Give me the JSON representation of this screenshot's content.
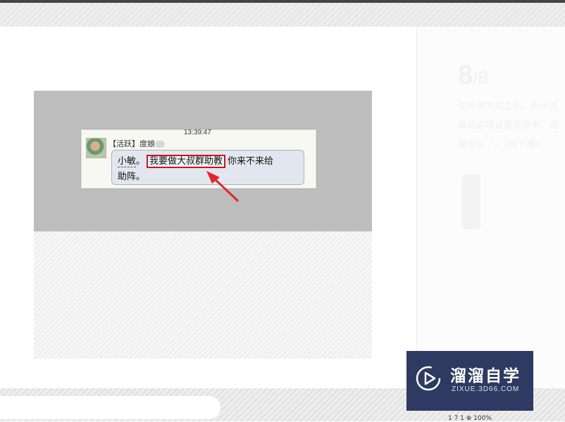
{
  "step": {
    "current": "8",
    "separator": "/",
    "total": "8",
    "text": "在修改完成之后，再点击来的选项设置菜单中，选就可以了。（如下图）"
  },
  "chat": {
    "time": "13:39:47",
    "sender": "【活跃】度娘",
    "mention": "小敏",
    "sep": "。",
    "highlighted": "我要做大叔群助教",
    "after": "你来不来给",
    "line2": "助阵。"
  },
  "bottom": {
    "meta": "1  7  1  ⊕  100%"
  },
  "watermark": {
    "title": "溜溜自学",
    "subtitle": "ZIXUE.3D66.COM"
  },
  "colors": {
    "highlight_border": "#c8171d",
    "watermark_bg": "#2e3a61"
  }
}
